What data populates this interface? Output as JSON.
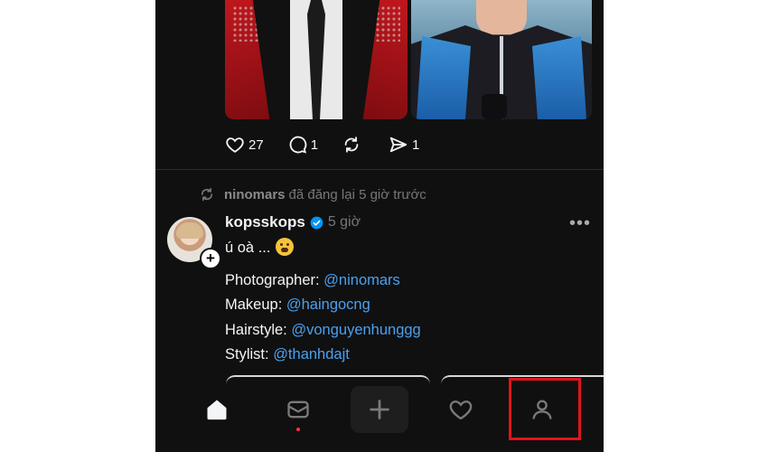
{
  "post_top": {
    "actions": {
      "likes": "27",
      "replies": "1",
      "reposts": "",
      "shares": "1"
    }
  },
  "post": {
    "repost_by": "ninomars",
    "repost_text": "đã đăng lại 5 giờ trước",
    "username": "kopsskops",
    "time": "5 giờ",
    "more": "•••",
    "caption": "ú oà ...",
    "credits": [
      {
        "label": "Photographer: ",
        "handle": "@ninomars"
      },
      {
        "label": "Makeup: ",
        "handle": "@haingocng"
      },
      {
        "label": "Hairstyle: ",
        "handle": "@vonguyenhunggg"
      },
      {
        "label": "Stylist: ",
        "handle": "@thanhdajt"
      }
    ]
  },
  "tabbar": {
    "tabs": [
      "home-icon",
      "mail-icon",
      "plus-icon",
      "heart-icon",
      "profile-icon"
    ]
  },
  "colors": {
    "background": "#101010",
    "mention": "#4aa1ef",
    "highlight": "#e0141b",
    "verified": "#0095f6"
  }
}
